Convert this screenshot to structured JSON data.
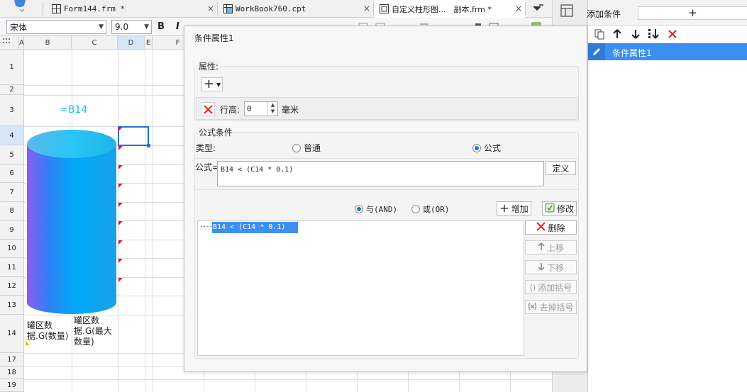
{
  "tabs": [
    {
      "label": "Form144.frm *",
      "close": "×"
    },
    {
      "label": "WorkBook760.cpt",
      "close": "×"
    },
    {
      "label": "自定义柱形图...　副本.frm *",
      "close": "×"
    }
  ],
  "toolbar": {
    "font_family": "宋体",
    "font_size": "9.0",
    "bold_label": "B",
    "italic_label": "I"
  },
  "sheet": {
    "columns": [
      "A",
      "B",
      "C",
      "D",
      "E",
      "F"
    ],
    "rows": [
      "1",
      "2",
      "3",
      "4",
      "5",
      "6",
      "7",
      "8",
      "9",
      "10",
      "11",
      "12",
      "13",
      "14",
      "17",
      "18",
      "19"
    ],
    "selected_column": "D",
    "selected_row": "4",
    "cell_b3": "=B14",
    "cell_b14": "罐区数据.G(数量)",
    "cell_c14": "罐区数据.G(最大数量)",
    "cylinder_colors": {
      "top": "#29c6f4",
      "body_light": "#00aaf6",
      "body_left": "#8a5cf0"
    }
  },
  "dialog": {
    "title": "条件属性1",
    "properties_label": "属性:",
    "add_symbol": "+",
    "row_height_label": "行高:",
    "row_height_value": "0",
    "row_height_unit": "毫米",
    "formula_condition_label": "公式条件",
    "type_label": "类型:",
    "type_normal": "普通",
    "type_formula": "公式",
    "formula_label": "公式=",
    "formula_value": "B14 < (C14 * 0.1)",
    "define_button": "定义",
    "and_label": "与(AND)",
    "or_label": "或(OR)",
    "add_button": "增加",
    "modify_button": "修改",
    "delete_button": "删除",
    "move_up_button": "上移",
    "move_down_button": "下移",
    "add_bracket_button": "添加括号",
    "remove_bracket_button": "去掉括号",
    "conditions": [
      "B14 < (C14 * 0.1)"
    ]
  },
  "panel": {
    "add_condition_label": "添加条件",
    "add_symbol": "+",
    "items": [
      "条件属性1"
    ],
    "accent": "#3c8ff0"
  }
}
